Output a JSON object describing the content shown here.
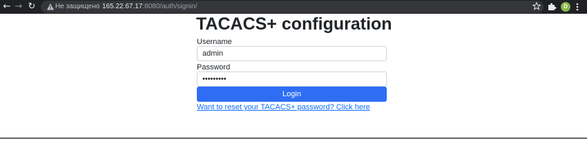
{
  "browser": {
    "address_bar": {
      "status": "Не защищено",
      "separator": "|",
      "host": "165.22.67.17",
      "path": ":8080/auth/signin/"
    },
    "profile_initial": "D",
    "icons": [
      "back-arrow-icon",
      "forward-arrow-icon",
      "reload-icon",
      "warning-icon",
      "star-icon",
      "extensions-puzzle-icon",
      "kebab-menu-icon"
    ]
  },
  "page": {
    "title": "TACACS+ configuration",
    "username_label": "Username",
    "username_value": "admin",
    "password_label": "Password",
    "password_mask": "•••••••••",
    "login_label": "Login",
    "reset_link": "Want to reset your TACACS+ password? Click here"
  },
  "colors": {
    "button_primary": "#2f6ef4",
    "link": "#0d6efd",
    "toolbar": "#202124"
  }
}
